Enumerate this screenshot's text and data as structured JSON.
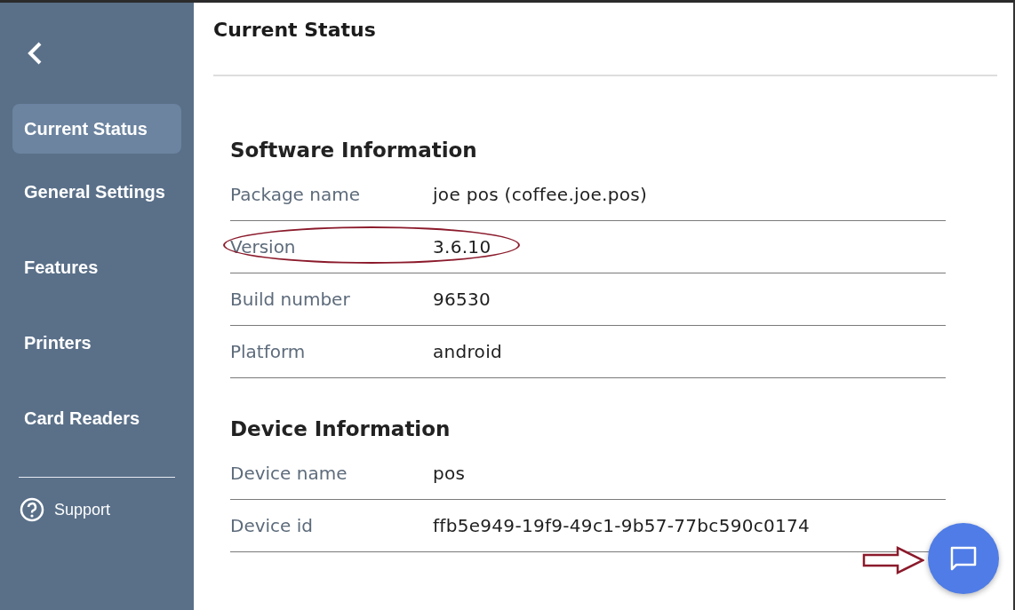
{
  "sidebar": {
    "items": [
      {
        "label": "Current Status",
        "selected": true
      },
      {
        "label": "General Settings",
        "selected": false
      },
      {
        "label": "Features",
        "selected": false
      },
      {
        "label": "Printers",
        "selected": false
      },
      {
        "label": "Card Readers",
        "selected": false
      }
    ],
    "support": "Support"
  },
  "header": {
    "title": "Current Status"
  },
  "sections": [
    {
      "title": "Software Information",
      "rows": [
        {
          "label": "Package name",
          "value": "joe pos (coffee.joe.pos)",
          "highlighted": false
        },
        {
          "label": "Version",
          "value": "3.6.10",
          "highlighted": true
        },
        {
          "label": "Build number",
          "value": "96530",
          "highlighted": false
        },
        {
          "label": "Platform",
          "value": "android",
          "highlighted": false
        }
      ]
    },
    {
      "title": "Device Information",
      "rows": [
        {
          "label": "Device name",
          "value": "pos",
          "highlighted": false
        },
        {
          "label": "Device id",
          "value": "ffb5e949-19f9-49c1-9b57-77bc590c0174",
          "highlighted": false
        }
      ]
    }
  ]
}
